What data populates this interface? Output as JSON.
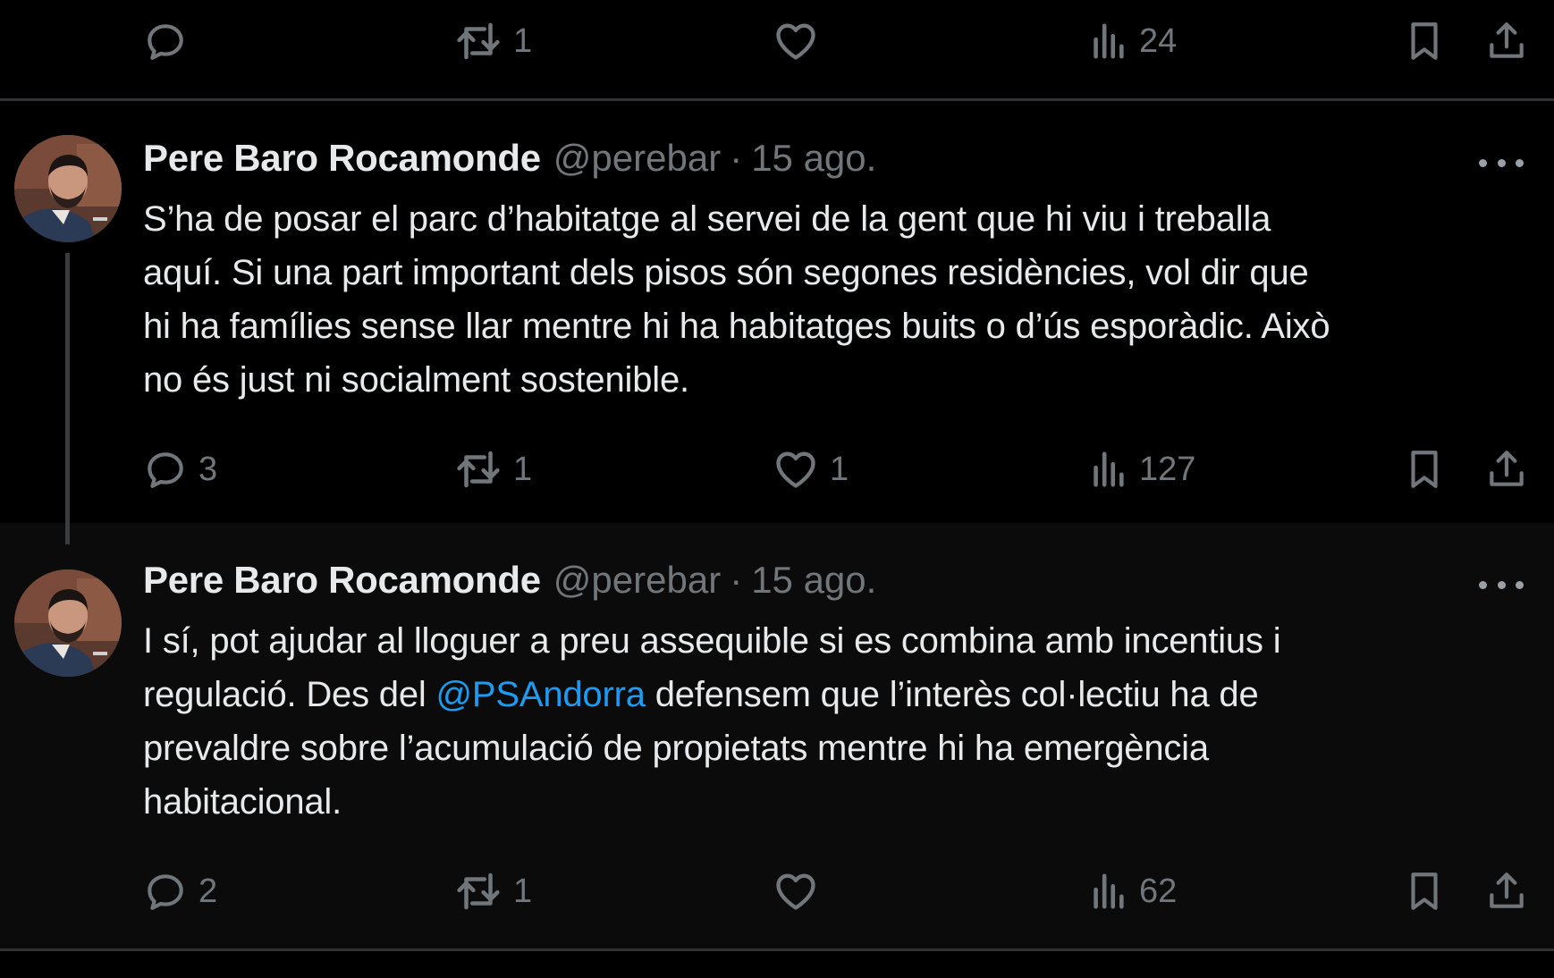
{
  "top_actions": {
    "replies": "",
    "reposts": "1",
    "likes": "",
    "views": "24"
  },
  "tweets": [
    {
      "name": "Pere Baro Rocamonde",
      "handle": "@perebar",
      "separator": "·",
      "date": "15 ago.",
      "lines": [
        "S’ha de posar el parc d’habitatge al servei de la gent que hi viu i treballa",
        "aquí. Si una part important dels pisos són segones residències, vol dir que",
        "hi ha famílies sense llar mentre hi ha habitatges buits o d’ús esporàdic. Això",
        "no és just ni socialment sostenible."
      ],
      "replies": "3",
      "reposts": "1",
      "likes": "1",
      "views": "127"
    },
    {
      "name": "Pere Baro Rocamonde",
      "handle": "@perebar",
      "separator": "·",
      "date": "15 ago.",
      "line1": "I sí, pot ajudar al lloguer a preu assequible si es combina amb incentius i",
      "line2_pre": "regulació. Des del ",
      "mention": "@PSAndorra",
      "line2_post": " defensem que l’interès col·lectiu ha de",
      "line3": "prevaldre sobre l’acumulació de propietats mentre hi ha emergència",
      "line4": "habitacional.",
      "replies": "2",
      "reposts": "1",
      "likes": "",
      "views": "62"
    }
  ],
  "icons": [
    "reply-icon",
    "repost-icon",
    "like-icon",
    "views-icon",
    "bookmark-icon",
    "share-icon",
    "more-icon"
  ],
  "colors": {
    "background": "#000000",
    "text": "#e7e9ea",
    "muted": "#71767b",
    "link": "#1d9bf0",
    "divider": "#2f3336"
  }
}
